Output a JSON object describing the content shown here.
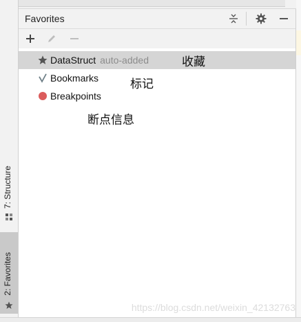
{
  "side_tabs": {
    "structure": {
      "label": "7: Structure",
      "icon": "structure-icon"
    },
    "favorites": {
      "label": "2: Favorites",
      "icon": "star-icon"
    }
  },
  "panel": {
    "title": "Favorites",
    "header_icons": [
      "collapse-all-icon",
      "gear-icon",
      "minimize-icon"
    ],
    "toolbar_icons": [
      "add-icon",
      "edit-icon",
      "remove-icon"
    ]
  },
  "tree": {
    "items": [
      {
        "label": "DataStruct",
        "hint": "auto-added",
        "icon": "star-icon",
        "selected": true
      },
      {
        "label": "Bookmarks",
        "hint": "",
        "icon": "check-icon",
        "selected": false
      },
      {
        "label": "Breakpoints",
        "hint": "",
        "icon": "breakpoint-dot-icon",
        "selected": false
      }
    ]
  },
  "annotations": {
    "favorites_note": "收藏",
    "bookmarks_note": "标记",
    "breakpoints_note": "断点信息"
  },
  "watermark": "https://blog.csdn.net/weixin_42132763",
  "colors": {
    "breakpoint_red": "#db5c5c",
    "selection_bg": "#d5d5d5",
    "hint_gray": "#8c8c8c"
  }
}
